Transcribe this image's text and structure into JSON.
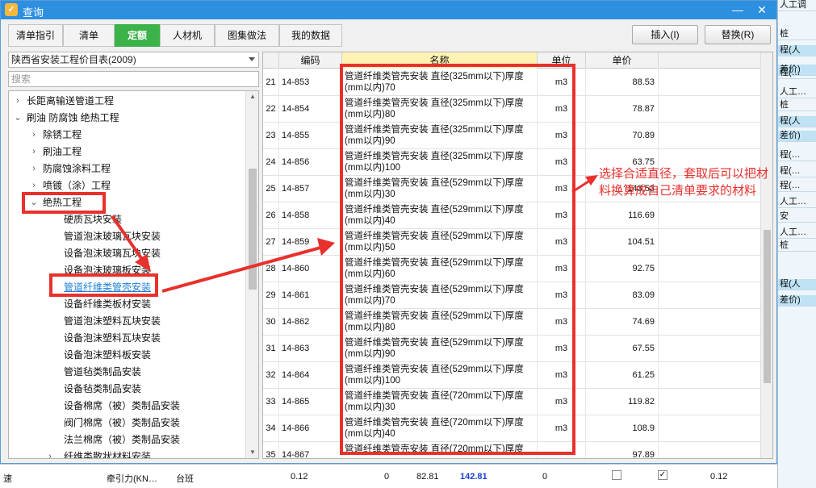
{
  "dialog": {
    "title": "查询",
    "minimize_glyph": "—",
    "close_glyph": "✕",
    "tabs": [
      {
        "label": "清单指引"
      },
      {
        "label": "清单"
      },
      {
        "label": "定额"
      },
      {
        "label": "人材机"
      },
      {
        "label": "图集做法"
      },
      {
        "label": "我的数据"
      }
    ],
    "insert_label": "插入(I)",
    "replace_label": "替换(R)"
  },
  "left": {
    "catalog_value": "陕西省安装工程价目表(2009)",
    "search_placeholder": "搜索",
    "tree": [
      {
        "label": "长距离输送管道工程",
        "depth": 0,
        "toggle": "›"
      },
      {
        "label": "刷油 防腐蚀 绝热工程",
        "depth": 0,
        "toggle": "⌄"
      },
      {
        "label": "除锈工程",
        "depth": 1,
        "toggle": "›"
      },
      {
        "label": "刷油工程",
        "depth": 1,
        "toggle": "›"
      },
      {
        "label": "防腐蚀涂料工程",
        "depth": 1,
        "toggle": "›"
      },
      {
        "label": "喷镀（涂）工程",
        "depth": 1,
        "toggle": "›"
      },
      {
        "label": "绝热工程",
        "depth": 1,
        "toggle": "⌄"
      },
      {
        "label": "硬质瓦块安装",
        "depth": 2,
        "toggle": ""
      },
      {
        "label": "管道泡沫玻璃瓦块安装",
        "depth": 2,
        "toggle": ""
      },
      {
        "label": "设备泡沫玻璃瓦块安装",
        "depth": 2,
        "toggle": ""
      },
      {
        "label": "设备泡沫玻璃板安装",
        "depth": 2,
        "toggle": ""
      },
      {
        "label": "管道纤维类管壳安装",
        "depth": 2,
        "toggle": "",
        "selected": true
      },
      {
        "label": "设备纤维类板材安装",
        "depth": 2,
        "toggle": ""
      },
      {
        "label": "管道泡沫塑料瓦块安装",
        "depth": 2,
        "toggle": ""
      },
      {
        "label": "设备泡沫塑料瓦块安装",
        "depth": 2,
        "toggle": ""
      },
      {
        "label": "设备泡沫塑料板安装",
        "depth": 2,
        "toggle": ""
      },
      {
        "label": "管道毡类制品安装",
        "depth": 2,
        "toggle": ""
      },
      {
        "label": "设备毡类制品安装",
        "depth": 2,
        "toggle": ""
      },
      {
        "label": "设备棉席（被）类制品安装",
        "depth": 2,
        "toggle": ""
      },
      {
        "label": "阀门棉席（被）类制品安装",
        "depth": 2,
        "toggle": ""
      },
      {
        "label": "法兰棉席（被）类制品安装",
        "depth": 2,
        "toggle": ""
      },
      {
        "label": "纤维类散状材料安装",
        "depth": 2,
        "toggle": "›"
      }
    ]
  },
  "grid": {
    "columns": [
      "编码",
      "名称",
      "单位",
      "单价"
    ],
    "rows": [
      {
        "no": "21",
        "code": "14-853",
        "name1": "管道纤维类管壳安装 直径(325mm以下)厚度",
        "name2": "(mm以内)70",
        "unit": "m3",
        "price": "88.53"
      },
      {
        "no": "22",
        "code": "14-854",
        "name1": "管道纤维类管壳安装 直径(325mm以下)厚度",
        "name2": "(mm以内)80",
        "unit": "m3",
        "price": "78.87"
      },
      {
        "no": "23",
        "code": "14-855",
        "name1": "管道纤维类管壳安装 直径(325mm以下)厚度",
        "name2": "(mm以内)90",
        "unit": "m3",
        "price": "70.89"
      },
      {
        "no": "24",
        "code": "14-856",
        "name1": "管道纤维类管壳安装 直径(325mm以下)厚度",
        "name2": "(mm以内)100",
        "unit": "m3",
        "price": "63.75"
      },
      {
        "no": "25",
        "code": "14-857",
        "name1": "管道纤维类管壳安装 直径(529mm以下)厚度",
        "name2": "(mm以内)30",
        "unit": "m3",
        "price": "143.53"
      },
      {
        "no": "26",
        "code": "14-858",
        "name1": "管道纤维类管壳安装 直径(529mm以下)厚度",
        "name2": "(mm以内)40",
        "unit": "m3",
        "price": "116.69"
      },
      {
        "no": "27",
        "code": "14-859",
        "name1": "管道纤维类管壳安装 直径(529mm以下)厚度",
        "name2": "(mm以内)50",
        "unit": "m3",
        "price": "104.51"
      },
      {
        "no": "28",
        "code": "14-860",
        "name1": "管道纤维类管壳安装 直径(529mm以下)厚度",
        "name2": "(mm以内)60",
        "unit": "m3",
        "price": "92.75"
      },
      {
        "no": "29",
        "code": "14-861",
        "name1": "管道纤维类管壳安装 直径(529mm以下)厚度",
        "name2": "(mm以内)70",
        "unit": "m3",
        "price": "83.09"
      },
      {
        "no": "30",
        "code": "14-862",
        "name1": "管道纤维类管壳安装 直径(529mm以下)厚度",
        "name2": "(mm以内)80",
        "unit": "m3",
        "price": "74.69"
      },
      {
        "no": "31",
        "code": "14-863",
        "name1": "管道纤维类管壳安装 直径(529mm以下)厚度",
        "name2": "(mm以内)90",
        "unit": "m3",
        "price": "67.55"
      },
      {
        "no": "32",
        "code": "14-864",
        "name1": "管道纤维类管壳安装 直径(529mm以下)厚度",
        "name2": "(mm以内)100",
        "unit": "m3",
        "price": "61.25"
      },
      {
        "no": "33",
        "code": "14-865",
        "name1": "管道纤维类管壳安装 直径(720mm以下)厚度",
        "name2": "(mm以内)30",
        "unit": "m3",
        "price": "119.82"
      },
      {
        "no": "34",
        "code": "14-866",
        "name1": "管道纤维类管壳安装 直径(720mm以下)厚度",
        "name2": "(mm以内)40",
        "unit": "m3",
        "price": "108.9"
      },
      {
        "no": "35",
        "code": "14-867",
        "name1": "管道纤维类管壳安装 直径(720mm以下)厚度",
        "name2": "",
        "unit": "",
        "price": "97.89"
      }
    ]
  },
  "annotation": {
    "text": "选择合适直径，套取后可以把材料换算成自己清单要求的材料",
    "color": "#e8312d"
  },
  "background": {
    "right_cells": [
      "人工调",
      "桩",
      "程(人",
      "差价)",
      "程(…",
      "人工…",
      "桩",
      "程(人",
      "差价)",
      "程(…",
      "程(…",
      "程(…",
      "人工…",
      "安",
      "人工…",
      "桩",
      "程(人",
      "差价)"
    ],
    "bottom": {
      "row_label": "牵引力(KN…",
      "unit": "台班",
      "qty": "0.12",
      "v1": "0",
      "v2": "82.81",
      "v3": "142.81",
      "v4": "0",
      "v5": "0.12"
    }
  },
  "colors": {
    "titlebar": "#2d8fe0",
    "active_tab": "#3bb24a",
    "selected_tree": "#1e7fd6",
    "highlight_header": "#fff3b3"
  }
}
